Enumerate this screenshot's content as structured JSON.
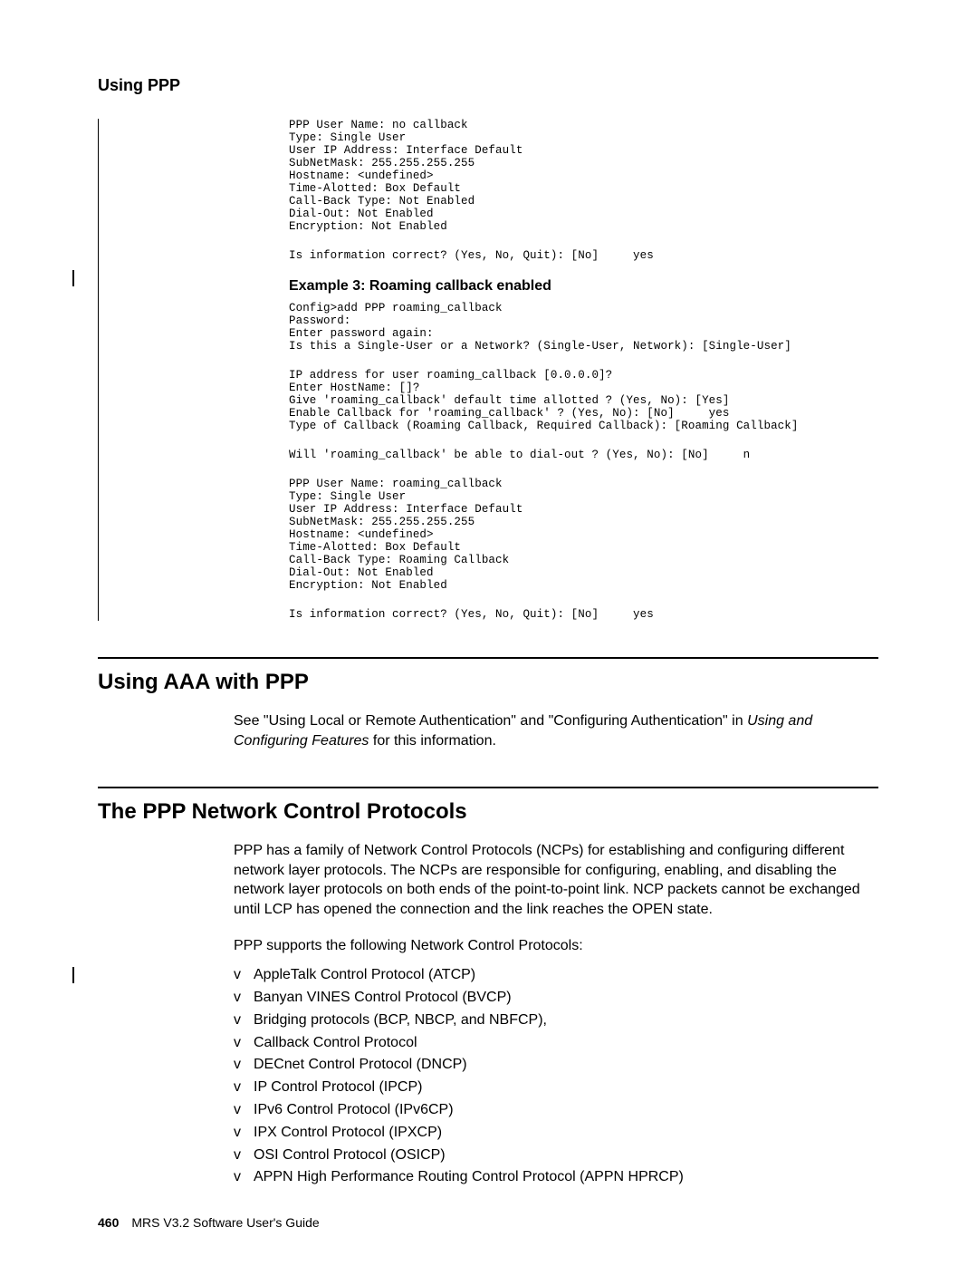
{
  "header": {
    "title": "Using PPP"
  },
  "example2": {
    "block1": "PPP User Name: no callback\nType: Single User\nUser IP Address: Interface Default\nSubNetMask: 255.255.255.255\nHostname: <undefined>\nTime-Alotted: Box Default\nCall-Back Type: Not Enabled\nDial-Out: Not Enabled\nEncryption: Not Enabled",
    "block2": "Is information correct? (Yes, No, Quit): [No]     yes"
  },
  "example3": {
    "title": "Example 3: Roaming callback enabled",
    "block1": "Config>add PPP roaming_callback\nPassword:\nEnter password again:\nIs this a Single-User or a Network? (Single-User, Network): [Single-User]",
    "block2": "IP address for user roaming_callback [0.0.0.0]?\nEnter HostName: []?\nGive 'roaming_callback' default time allotted ? (Yes, No): [Yes]\nEnable Callback for 'roaming_callback' ? (Yes, No): [No]     yes\nType of Callback (Roaming Callback, Required Callback): [Roaming Callback]",
    "block3": "Will 'roaming_callback' be able to dial-out ? (Yes, No): [No]     n",
    "block4": "PPP User Name: roaming_callback\nType: Single User\nUser IP Address: Interface Default\nSubNetMask: 255.255.255.255\nHostname: <undefined>\nTime-Alotted: Box Default\nCall-Back Type: Roaming Callback\nDial-Out: Not Enabled\nEncryption: Not Enabled",
    "block5": "Is information correct? (Yes, No, Quit): [No]     yes"
  },
  "sectionA": {
    "heading": "Using AAA with PPP",
    "para_plain1": "See \"Using Local or Remote Authentication\" and \"Configuring Authentication\" in ",
    "para_italic": "Using and Configuring Features",
    "para_plain2": " for this information."
  },
  "sectionB": {
    "heading": "The PPP Network Control Protocols",
    "para1": "PPP has a family of Network Control Protocols (NCPs) for establishing and configuring different network layer protocols. The NCPs are responsible for configuring, enabling, and disabling the network layer protocols on both ends of the point-to-point link. NCP packets cannot be exchanged until LCP has opened the connection and the link reaches the OPEN state.",
    "para2": "PPP supports the following Network Control Protocols:",
    "bullets": [
      "AppleTalk Control Protocol (ATCP)",
      "Banyan VINES Control Protocol (BVCP)",
      "Bridging protocols (BCP, NBCP, and NBFCP),",
      "Callback Control Protocol",
      "DECnet Control Protocol (DNCP)",
      "IP Control Protocol (IPCP)",
      "IPv6 Control Protocol (IPv6CP)",
      "IPX Control Protocol (IPXCP)",
      "OSI Control Protocol (OSICP)",
      "APPN High Performance Routing Control Protocol (APPN HPRCP)"
    ]
  },
  "footer": {
    "page": "460",
    "title": "MRS V3.2 Software User's Guide"
  }
}
